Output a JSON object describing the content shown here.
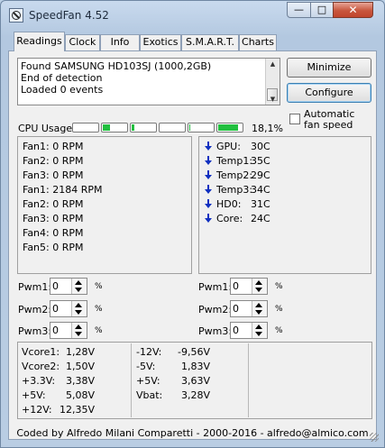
{
  "window": {
    "title": "SpeedFan 4.52",
    "controls": {
      "minimize": "—",
      "maximize": "□",
      "close": "✕"
    }
  },
  "tabs": [
    {
      "label": "Readings",
      "active": true
    },
    {
      "label": "Clock"
    },
    {
      "label": "Info"
    },
    {
      "label": "Exotics"
    },
    {
      "label": "S.M.A.R.T."
    },
    {
      "label": "Charts"
    }
  ],
  "log": [
    "Found SAMSUNG HD103SJ (1000,2GB)",
    "End of detection",
    "Loaded 0 events"
  ],
  "buttons": {
    "minimize": "Minimize",
    "configure": "Configure"
  },
  "auto_fan": {
    "label": "Automatic fan speed",
    "checked": false
  },
  "cpu_usage": {
    "label": "CPU Usage",
    "total": "18,1%",
    "cores": [
      0.0,
      0.3,
      0.1,
      0.0,
      0.05,
      0.85
    ],
    "bar_color": "#22c040"
  },
  "fans": [
    {
      "label": "Fan1: 0 RPM"
    },
    {
      "label": "Fan2: 0 RPM"
    },
    {
      "label": "Fan3: 0 RPM"
    },
    {
      "label": "Fan1: 2184 RPM"
    },
    {
      "label": "Fan2: 0 RPM"
    },
    {
      "label": "Fan3: 0 RPM"
    },
    {
      "label": "Fan4: 0 RPM"
    },
    {
      "label": "Fan5: 0 RPM"
    }
  ],
  "temps": [
    {
      "name": "GPU:",
      "value": "30C",
      "trend": "down"
    },
    {
      "name": "Temp1:",
      "value": "35C",
      "trend": "down"
    },
    {
      "name": "Temp2:",
      "value": "29C",
      "trend": "down"
    },
    {
      "name": "Temp3:",
      "value": "34C",
      "trend": "down"
    },
    {
      "name": "HD0:",
      "value": "31C",
      "trend": "down"
    },
    {
      "name": "Core:",
      "value": "24C",
      "trend": "down"
    }
  ],
  "trend_color": "#1030c0",
  "pwm": {
    "left": [
      {
        "label": "Pwm1:",
        "value": "0"
      },
      {
        "label": "Pwm2:",
        "value": "0"
      },
      {
        "label": "Pwm3:",
        "value": "0"
      }
    ],
    "right": [
      {
        "label": "Pwm1:",
        "value": "0"
      },
      {
        "label": "Pwm2:",
        "value": "0"
      },
      {
        "label": "Pwm3:",
        "value": "0"
      }
    ],
    "unit": "%"
  },
  "voltages": {
    "col1": [
      {
        "name": "Vcore1:",
        "value": "1,28V"
      },
      {
        "name": "Vcore2:",
        "value": "1,50V"
      },
      {
        "name": "+3.3V:",
        "value": "3,38V"
      },
      {
        "name": "+5V:",
        "value": "5,08V"
      },
      {
        "name": "+12V:",
        "value": "12,35V"
      }
    ],
    "col2": [
      {
        "name": "-12V:",
        "value": "-9,56V"
      },
      {
        "name": "-5V:",
        "value": "1,83V"
      },
      {
        "name": "+5V:",
        "value": "3,63V"
      },
      {
        "name": "Vbat:",
        "value": "3,28V"
      }
    ]
  },
  "footer": "Coded by Alfredo Milani Comparetti - 2000-2016 - alfredo@almico.com"
}
